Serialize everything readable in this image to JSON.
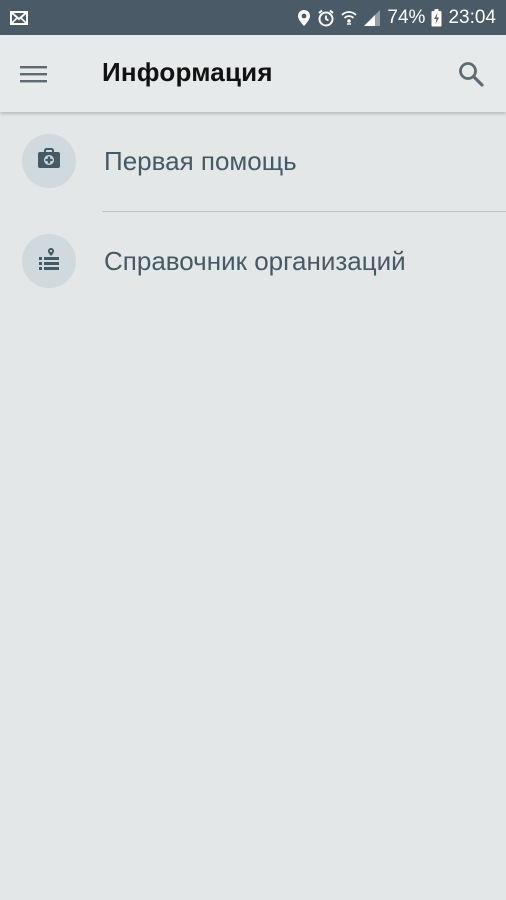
{
  "status_bar": {
    "battery": "74%",
    "time": "23:04",
    "icons": [
      "mail-icon",
      "location-icon",
      "alarm-icon",
      "wifi-icon",
      "signal-icon",
      "battery-charging-icon"
    ]
  },
  "app_bar": {
    "title": "Информация",
    "icons": [
      "menu-icon",
      "search-icon"
    ]
  },
  "items": [
    {
      "label": "Первая помощь",
      "icon": "first-aid-kit-icon"
    },
    {
      "label": "Справочник организаций",
      "icon": "organization-directory-icon"
    }
  ],
  "colors": {
    "status_bar": "#4a5a66",
    "app_bar": "#e7eaeb",
    "background": "#e3e7e8",
    "item_text": "#455a64",
    "avatar_bg": "#d0d9dd"
  }
}
